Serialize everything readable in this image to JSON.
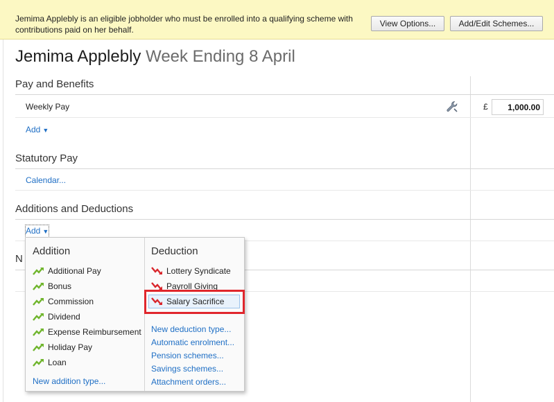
{
  "notice": {
    "text": "Jemima Applebly is an eligible jobholder who must be enrolled into a qualifying scheme with contributions paid on her behalf.",
    "view_options": "View Options...",
    "add_edit_schemes": "Add/Edit Schemes..."
  },
  "header": {
    "employee_name": "Jemima Applebly",
    "period": "Week Ending 8 April"
  },
  "pay_and_benefits": {
    "title": "Pay and Benefits",
    "row_label": "Weekly Pay",
    "currency": "£",
    "amount": "1,000.00",
    "add_label": "Add"
  },
  "statutory_pay": {
    "title": "Statutory Pay",
    "calendar_link": "Calendar..."
  },
  "additions_deductions": {
    "title": "Additions and Deductions",
    "add_label": "Add"
  },
  "hidden_section": {
    "partial_title": "N"
  },
  "dropdown": {
    "addition": {
      "title": "Addition",
      "items": [
        "Additional Pay",
        "Bonus",
        "Commission",
        "Dividend",
        "Expense Reimbursement",
        "Holiday Pay",
        "Loan"
      ],
      "new_link": "New addition type..."
    },
    "deduction": {
      "title": "Deduction",
      "items": [
        "Lottery Syndicate",
        "Payroll Giving",
        "Salary Sacrifice"
      ],
      "selected": "Salary Sacrifice",
      "links": [
        "New deduction type...",
        "Automatic enrolment...",
        "Pension schemes...",
        "Savings schemes...",
        "Attachment orders..."
      ]
    }
  },
  "colors": {
    "link": "#1f6fc5",
    "notice_bg": "#fcf8c3",
    "highlight": "#e0262c",
    "addition_icon": "#6fb52c",
    "deduction_icon": "#d9262c"
  },
  "icons": {
    "settings": "wrench-icon",
    "addition": "trend-up-icon",
    "deduction": "trend-down-icon"
  }
}
